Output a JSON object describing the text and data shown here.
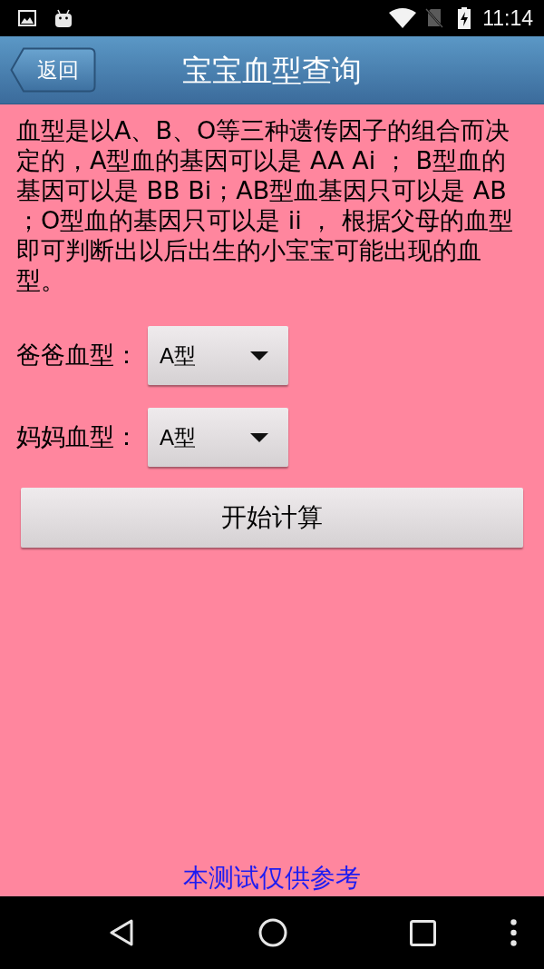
{
  "status_bar": {
    "time": "11:14"
  },
  "header": {
    "back_button": "返回",
    "title": "宝宝血型查询"
  },
  "description": "血型是以A、B、O等三种遗传因子的组合而决定的，A型血的基因可以是 AA Ai ； B型血的基因可以是 BB Bi；AB型血基因只可以是 AB ；O型血的基因只可以是 ii ， 根据父母的血型即可判断出以后出生的小宝宝可能出现的血型。",
  "fields": [
    {
      "label": "爸爸血型：",
      "value": "A型"
    },
    {
      "label": "妈妈血型：",
      "value": "A型"
    }
  ],
  "calculate_button": "开始计算",
  "footer_note": "本测试仅供参考"
}
